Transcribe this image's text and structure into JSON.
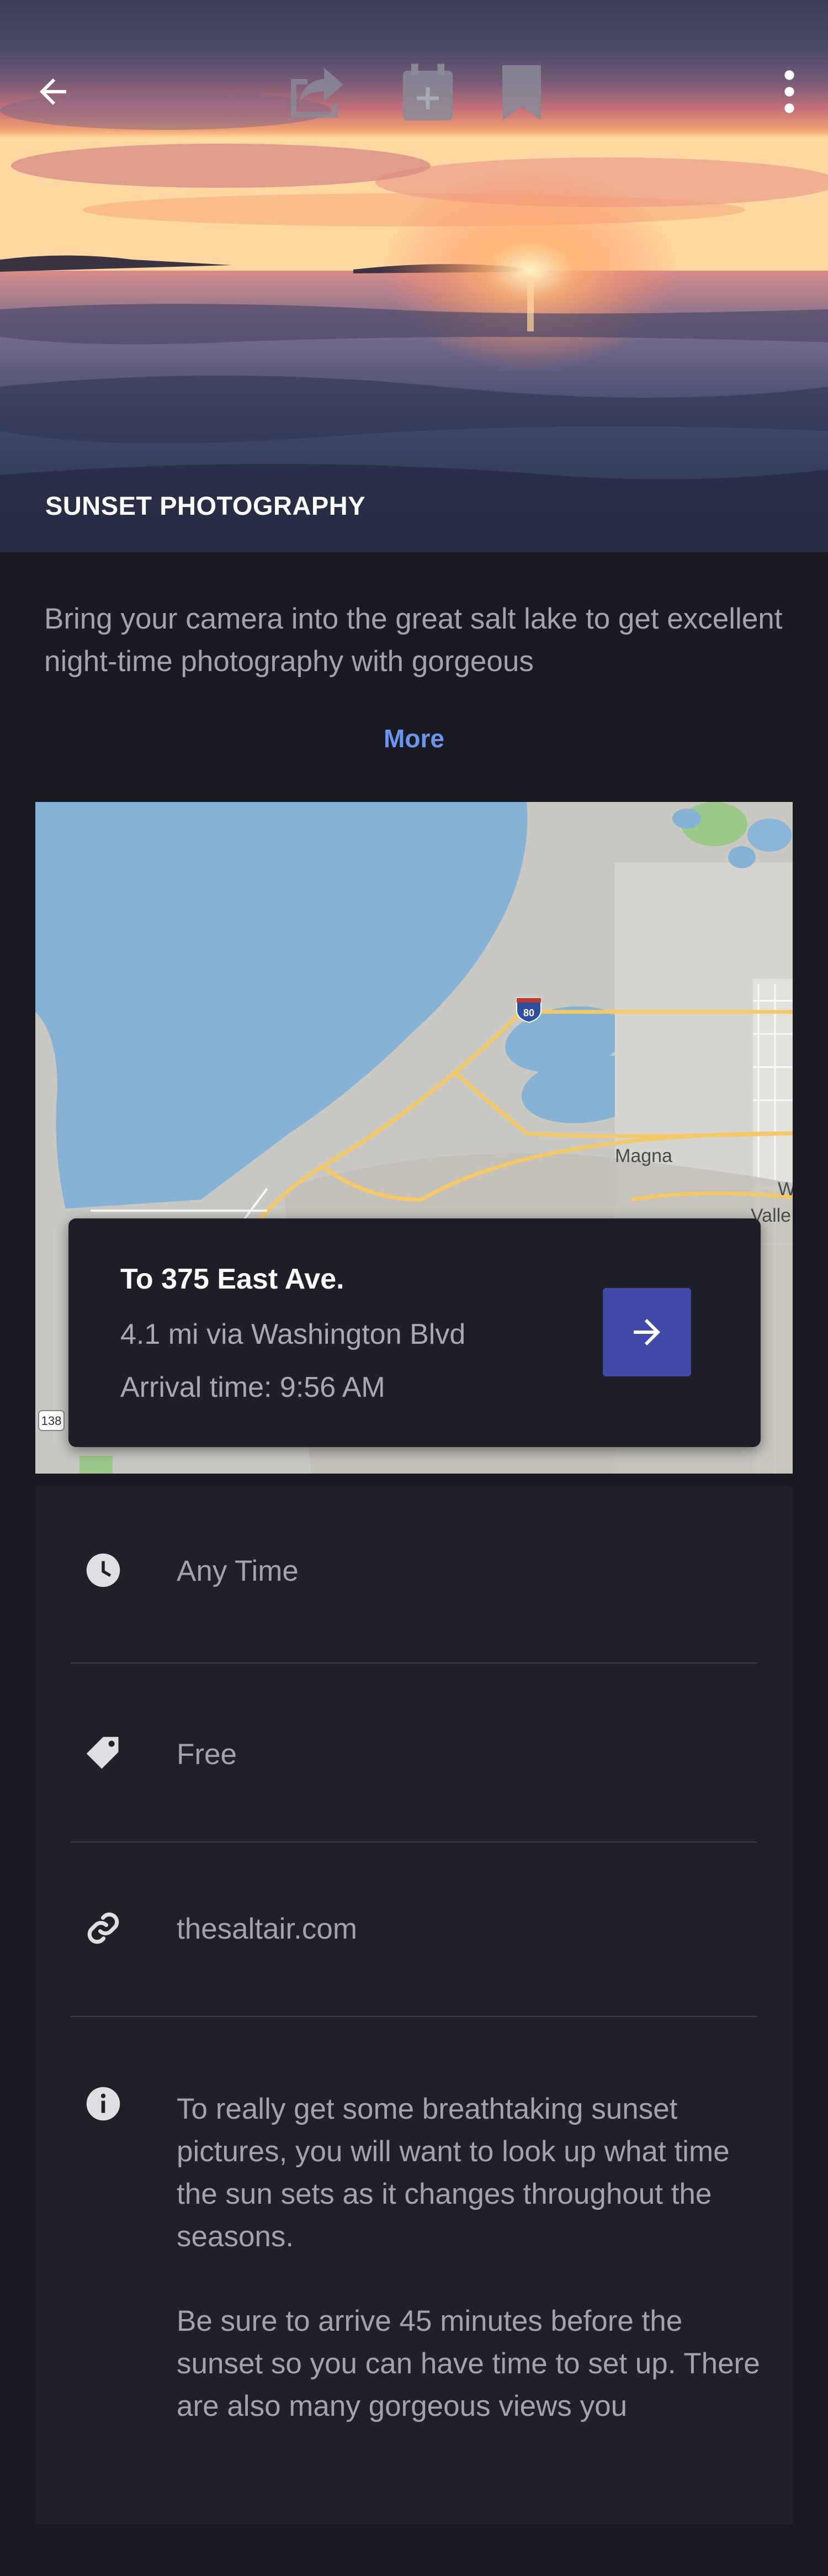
{
  "hero": {
    "title": "SUNSET PHOTOGRAPHY",
    "icons": [
      "back-arrow-icon",
      "share-icon",
      "calendar-add-icon",
      "bookmark-icon",
      "more-vert-icon"
    ]
  },
  "description": {
    "text": "Bring your camera into the great salt lake to get excellent night-time photography with gorgeous",
    "more_label": "More"
  },
  "map": {
    "labels": {
      "highway": "80",
      "town1": "Magna",
      "town2": "W",
      "town3": "Valle",
      "road": "138"
    },
    "route": {
      "title": "To 375 East Ave.",
      "distance": "4.1 mi via Washington Blvd",
      "arrival": "Arrival time: 9:56 AM",
      "icon": "arrow-right-icon"
    }
  },
  "details": {
    "time": {
      "icon": "clock-icon",
      "text": "Any Time"
    },
    "price": {
      "icon": "tag-icon",
      "text": "Free"
    },
    "website": {
      "icon": "link-icon",
      "text": "thesaltair.com"
    },
    "info": {
      "icon": "info-icon",
      "paragraph1": "To really get some breathtaking sunset pictures, you will want to look up what time the sun sets as it changes throughout the seasons.",
      "paragraph2": "Be sure to arrive 45 minutes before the sunset so you can have time to set up. There are also many gorgeous views you"
    }
  },
  "colors": {
    "background": "#1a1a23",
    "panel": "#212029",
    "accent_link": "#6b96f0",
    "button": "#3e49a8"
  }
}
